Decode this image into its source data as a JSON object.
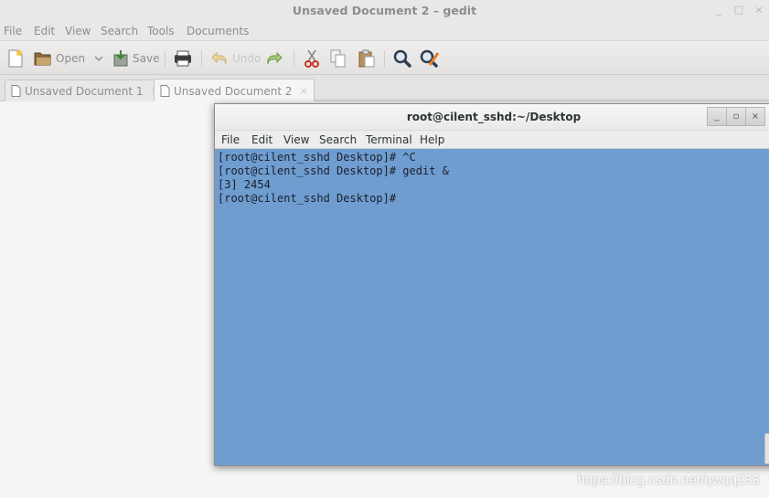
{
  "gedit": {
    "title": "Unsaved Document 2 – gedit",
    "window_buttons": [
      "_",
      "□",
      "×"
    ],
    "menu": [
      "File",
      "Edit",
      "View",
      "Search",
      "Tools",
      "Documents"
    ],
    "toolbar": {
      "open_label": "Open",
      "save_label": "Save",
      "undo_label": "Undo"
    },
    "tabs": [
      {
        "label": "Unsaved Document 1",
        "close": "×"
      },
      {
        "label": "Unsaved Document 2",
        "close": "×"
      }
    ]
  },
  "terminal": {
    "title": "root@cilent_sshd:~/Desktop",
    "window_buttons": [
      "_",
      "▫",
      "×"
    ],
    "menu": [
      "File",
      "Edit",
      "View",
      "Search",
      "Terminal",
      "Help"
    ],
    "lines": [
      "[root@cilent_sshd Desktop]# ^C",
      "[root@cilent_sshd Desktop]# gedit &",
      "[3] 2454",
      "[root@cilent_sshd Desktop]# "
    ],
    "background": "#6f9dd0"
  },
  "watermark": "https://blog.csdn.net/qwqq233"
}
